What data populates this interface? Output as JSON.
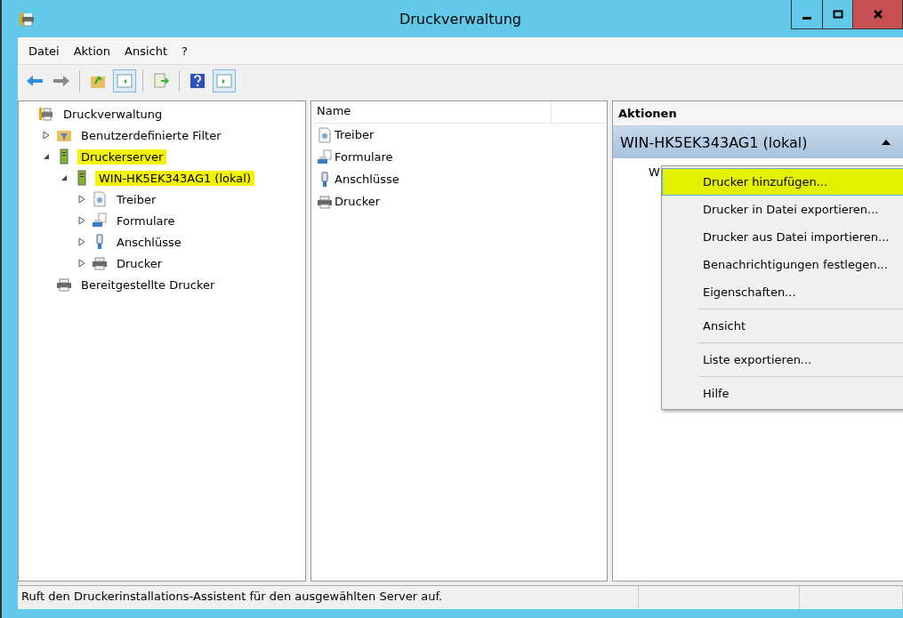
{
  "window": {
    "title": "Druckverwaltung",
    "controls": [
      {
        "kind": "minimize"
      },
      {
        "kind": "maximize"
      },
      {
        "kind": "close"
      }
    ]
  },
  "menu": [
    "Datei",
    "Aktion",
    "Ansicht",
    "?"
  ],
  "toolbar": [
    {
      "buttons": [
        {
          "kind": "back",
          "pressed": false
        },
        {
          "kind": "forward",
          "pressed": false
        }
      ]
    },
    {
      "buttons": [
        {
          "kind": "up",
          "pressed": false
        },
        {
          "kind": "tree",
          "pressed": true
        }
      ]
    },
    {
      "buttons": [
        {
          "kind": "export",
          "pressed": false
        }
      ]
    },
    {
      "buttons": [
        {
          "kind": "help",
          "pressed": false
        },
        {
          "kind": "actions",
          "pressed": true
        }
      ]
    }
  ],
  "tree": [
    {
      "label": "Druckverwaltung",
      "kind": "app",
      "highlighted": false,
      "children": [
        {
          "label": "Benutzerdefinierte Filter",
          "kind": "filter",
          "expanded": false,
          "highlighted": false
        },
        {
          "label": "Druckerserver",
          "kind": "server",
          "expanded": true,
          "highlighted": true,
          "children": [
            {
              "label": "WIN-HK5EK343AG1 (lokal)",
              "kind": "server",
              "expanded": true,
              "highlighted": true,
              "children": [
                {
                  "label": "Treiber",
                  "kind": "driver",
                  "expanded": false,
                  "highlighted": false
                },
                {
                  "label": "Formulare",
                  "kind": "forms",
                  "expanded": false,
                  "highlighted": false
                },
                {
                  "label": "Anschlüsse",
                  "kind": "port",
                  "expanded": false,
                  "highlighted": false
                },
                {
                  "label": "Drucker",
                  "kind": "printer",
                  "expanded": false,
                  "highlighted": false
                }
              ]
            }
          ]
        },
        {
          "label": "Bereitgestellte Drucker",
          "kind": "printer",
          "highlighted": false
        }
      ]
    }
  ],
  "list": {
    "columns": [
      "Name"
    ],
    "rows": [
      {
        "label": "Treiber",
        "kind": "driver"
      },
      {
        "label": "Formulare",
        "kind": "forms"
      },
      {
        "label": "Anschlüsse",
        "kind": "port"
      },
      {
        "label": "Drucker",
        "kind": "printer"
      }
    ]
  },
  "actions": {
    "title": "Aktionen",
    "section": "WIN-HK5EK343AG1 (lokal)",
    "item_fragment": "W"
  },
  "context_menu": [
    {
      "items": [
        {
          "label": "Drucker hinzufügen...",
          "selected": true,
          "highlighted": true
        },
        {
          "label": "Drucker in Datei exportieren...",
          "selected": false,
          "highlighted": false
        },
        {
          "label": "Drucker aus Datei importieren...",
          "selected": false,
          "highlighted": false
        },
        {
          "label": "Benachrichtigungen festlegen...",
          "selected": false,
          "highlighted": false
        },
        {
          "label": "Eigenschaften...",
          "selected": false,
          "highlighted": false
        }
      ]
    },
    {
      "items": [
        {
          "label": "Ansicht",
          "selected": false,
          "highlighted": false
        }
      ]
    },
    {
      "items": [
        {
          "label": "Liste exportieren...",
          "selected": false,
          "highlighted": false
        }
      ]
    },
    {
      "items": [
        {
          "label": "Hilfe",
          "selected": false,
          "highlighted": false
        }
      ]
    }
  ],
  "status_bar": {
    "text": "Ruft den Druckerinstallations-Assistent für den ausgewählten Server auf."
  }
}
